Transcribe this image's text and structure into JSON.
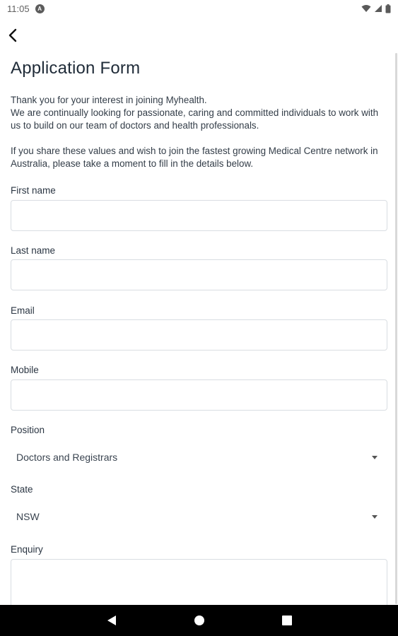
{
  "status_bar": {
    "time": "11:05",
    "notification_icon": "a-icon",
    "wifi_icon": "wifi-icon",
    "signal_icon": "signal-icon",
    "battery_icon": "battery-icon"
  },
  "app_bar": {
    "back_icon": "back-arrow-icon"
  },
  "page": {
    "title": "Application Form",
    "intro_p1_line1": "Thank you for your interest in joining Myhealth.",
    "intro_p1_line2": "We are continually looking for passionate, caring and committed individuals to work with us to build on our team of doctors and health professionals.",
    "intro_p2": "If you share these values and wish to join the fastest growing Medical Centre network in Australia, please take a moment to fill in the details below."
  },
  "form": {
    "first_name": {
      "label": "First name",
      "value": ""
    },
    "last_name": {
      "label": "Last name",
      "value": ""
    },
    "email": {
      "label": "Email",
      "value": ""
    },
    "mobile": {
      "label": "Mobile",
      "value": ""
    },
    "position": {
      "label": "Position",
      "selected": "Doctors and Registrars"
    },
    "state": {
      "label": "State",
      "selected": "NSW"
    },
    "enquiry": {
      "label": "Enquiry",
      "value": ""
    }
  },
  "nav_bar": {
    "back_icon": "nav-back-icon",
    "home_icon": "nav-home-icon",
    "recents_icon": "nav-recents-icon"
  },
  "colors": {
    "text_primary": "#1f2b38",
    "field_border": "#d9dde2",
    "nav_background": "#000000"
  }
}
